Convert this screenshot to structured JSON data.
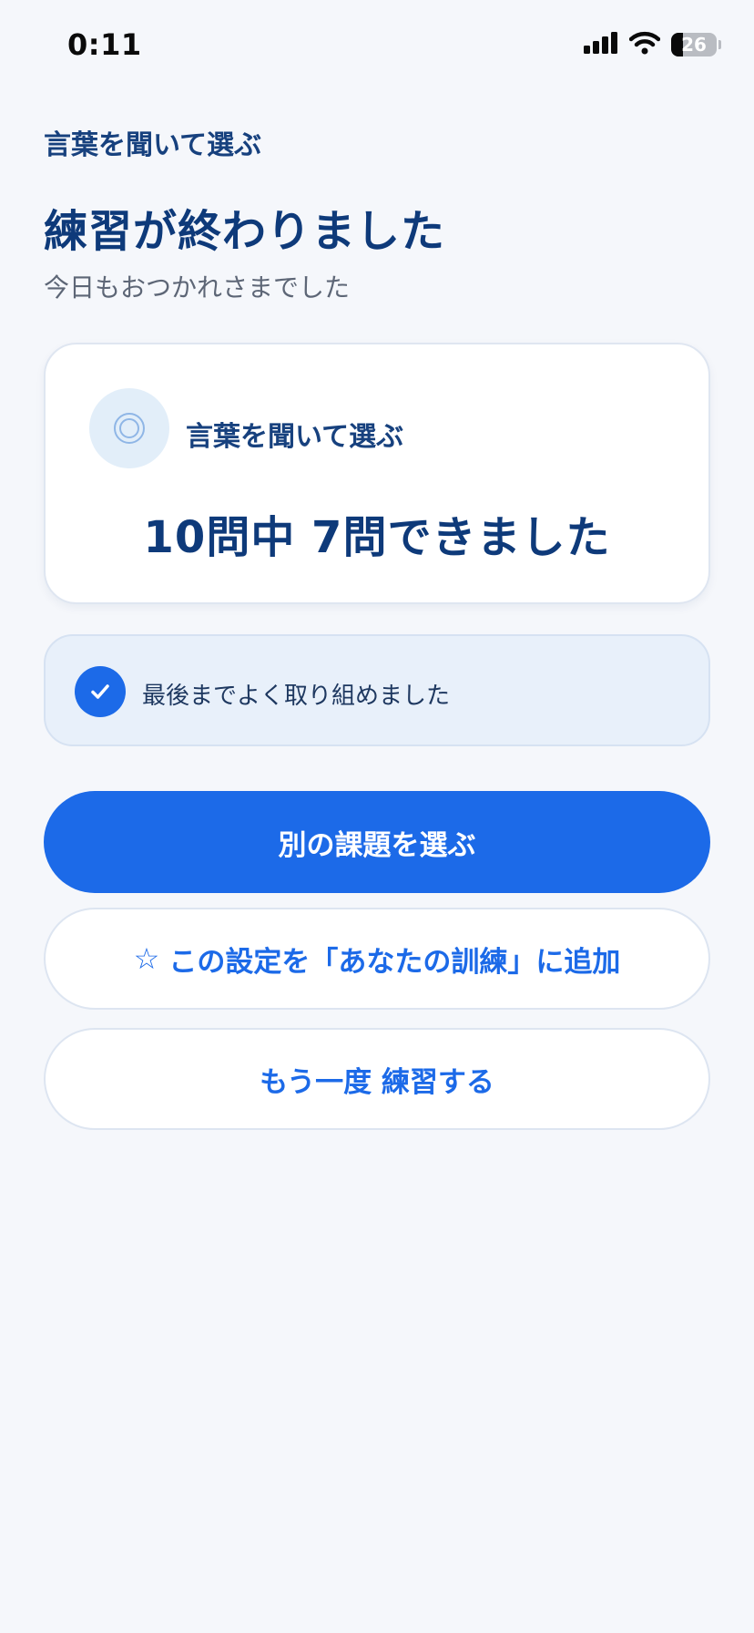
{
  "status_bar": {
    "time": "0:11",
    "battery": "26"
  },
  "header": {
    "eyebrow": "言葉を聞いて選ぶ",
    "title": "練習が終わりました",
    "subtitle": "今日もおつかれさまでした"
  },
  "score_card": {
    "task_name": "言葉を聞いて選ぶ",
    "score": "10問中 7問できました",
    "icon": "target-icon"
  },
  "praise": {
    "message": "最後までよく取り組めました",
    "icon": "check-icon"
  },
  "actions": {
    "choose_other": "別の課題を選ぶ",
    "add_to_training_icon": "☆",
    "add_to_training": "この設定を「あなたの訓練」に追加",
    "retry": "もう一度 練習する"
  },
  "colors": {
    "accent": "#1c6ae8",
    "heading": "#0e3a7a",
    "background": "#f5f7fb"
  }
}
